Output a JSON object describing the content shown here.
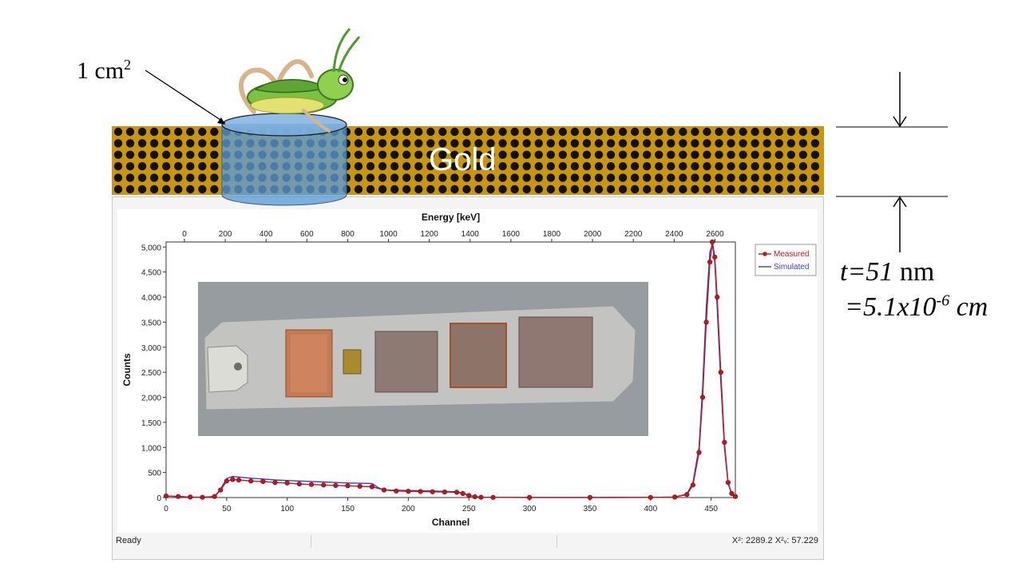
{
  "annotations": {
    "area_label": "1 cm",
    "area_exponent": "2",
    "gold_label": "Gold",
    "thickness_t": "t=51",
    "thickness_unit": " nm",
    "thickness_cm_prefix": "=5.1x10",
    "thickness_cm_exp": "-6",
    "thickness_cm_unit": " cm"
  },
  "status_bar": {
    "ready": "Ready",
    "chi_text": "X²: 2289.2   X²ᵥ: 57.229"
  },
  "colors": {
    "gold": "#c9960c",
    "dot": "#111111",
    "cylinder": "#5b9bd5",
    "measured": "#c0171c",
    "simulated": "#3c3cc8"
  },
  "chart_data": {
    "type": "line",
    "xlabel": "Channel",
    "ylabel": "Counts",
    "top_xlabel": "Energy [keV]",
    "xlim": [
      0,
      470
    ],
    "ylim": [
      0,
      5100
    ],
    "x_ticks": [
      0,
      50,
      100,
      150,
      200,
      250,
      300,
      350,
      400,
      450
    ],
    "y_ticks": [
      0,
      500,
      1000,
      1500,
      2000,
      2500,
      3000,
      3500,
      4000,
      4500,
      5000
    ],
    "y_tick_labels": [
      "0",
      "500",
      "1,000",
      "1,500",
      "2,000",
      "2,500",
      "3,000",
      "3,500",
      "4,000",
      "4,500",
      "5,000"
    ],
    "top_ticks": [
      0,
      200,
      400,
      600,
      800,
      1000,
      1200,
      1400,
      1600,
      1800,
      2000,
      2200,
      2400,
      2600
    ],
    "top_xlim": [
      -90,
      2700
    ],
    "legend": [
      "Measured",
      "Simulated"
    ],
    "legend_position": "outside-top-right",
    "series": [
      {
        "name": "Measured",
        "x": [
          0,
          10,
          20,
          30,
          40,
          45,
          50,
          55,
          60,
          70,
          80,
          90,
          100,
          110,
          120,
          130,
          140,
          150,
          160,
          170,
          180,
          190,
          200,
          210,
          220,
          230,
          240,
          245,
          250,
          255,
          260,
          270,
          300,
          350,
          400,
          420,
          430,
          435,
          440,
          443,
          446,
          449,
          451,
          453,
          455,
          458,
          461,
          464,
          467,
          470
        ],
        "y": [
          30,
          20,
          10,
          5,
          20,
          150,
          330,
          360,
          350,
          330,
          320,
          300,
          290,
          270,
          260,
          250,
          240,
          235,
          225,
          215,
          150,
          130,
          125,
          120,
          115,
          110,
          105,
          80,
          40,
          15,
          5,
          3,
          2,
          2,
          3,
          10,
          60,
          250,
          900,
          2000,
          3500,
          4700,
          5100,
          4800,
          4000,
          2500,
          1100,
          300,
          80,
          20
        ]
      },
      {
        "name": "Simulated",
        "x": [
          0,
          10,
          20,
          30,
          40,
          45,
          50,
          55,
          60,
          70,
          80,
          90,
          100,
          110,
          120,
          130,
          140,
          150,
          160,
          170,
          175,
          180,
          200,
          220,
          240,
          245,
          250,
          255,
          260,
          270,
          300,
          350,
          400,
          420,
          430,
          435,
          440,
          443,
          446,
          449,
          451,
          453,
          455,
          458,
          461,
          464,
          467,
          470
        ],
        "y": [
          30,
          20,
          10,
          5,
          20,
          170,
          380,
          420,
          410,
          385,
          370,
          350,
          340,
          330,
          320,
          310,
          300,
          290,
          285,
          280,
          200,
          150,
          140,
          130,
          115,
          85,
          45,
          15,
          5,
          3,
          2,
          2,
          3,
          10,
          70,
          300,
          1000,
          2200,
          3800,
          4900,
          5050,
          4700,
          3800,
          2300,
          1000,
          280,
          70,
          20
        ]
      }
    ]
  }
}
